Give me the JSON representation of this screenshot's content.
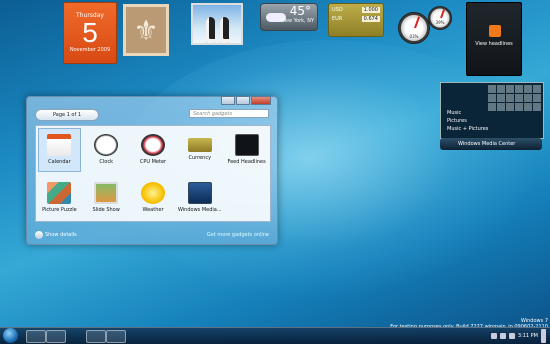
{
  "desktop": {
    "calendar": {
      "weekday": "Thursday",
      "day": "5",
      "month_year": "November 2009"
    },
    "weather": {
      "temp": "45°",
      "city": "New York, NY"
    },
    "currency": {
      "rows": [
        {
          "code": "USD",
          "value": "1.000"
        },
        {
          "code": "EUR",
          "value": "0.674"
        }
      ]
    },
    "cpu_meter": {
      "cpu": "03%",
      "mem": "39%"
    },
    "feed": {
      "label": "View headlines"
    },
    "media_center": {
      "items": [
        "Music",
        "Pictures",
        "Music + Pictures"
      ],
      "bar_label": "Windows Media Center"
    },
    "watermark": {
      "line1": "Windows 7",
      "line2": "For testing purposes only. Build 7227.winmain_ip.090602-2110"
    }
  },
  "gallery": {
    "page_label": "Page 1 of 1",
    "search_placeholder": "Search gadgets",
    "items": [
      {
        "label": "Calendar",
        "icon": "calendar-icon"
      },
      {
        "label": "Clock",
        "icon": "clock-icon"
      },
      {
        "label": "CPU Meter",
        "icon": "cpu-meter-icon"
      },
      {
        "label": "Currency",
        "icon": "currency-icon"
      },
      {
        "label": "Feed Headlines",
        "icon": "feed-icon"
      },
      {
        "label": "Picture Puzzle",
        "icon": "puzzle-icon"
      },
      {
        "label": "Slide Show",
        "icon": "slideshow-icon"
      },
      {
        "label": "Weather",
        "icon": "weather-icon"
      },
      {
        "label": "Windows Media...",
        "icon": "media-center-icon"
      }
    ],
    "show_details": "Show details",
    "get_more": "Get more gadgets online"
  },
  "taskbar": {
    "clock": "3:11 PM"
  }
}
